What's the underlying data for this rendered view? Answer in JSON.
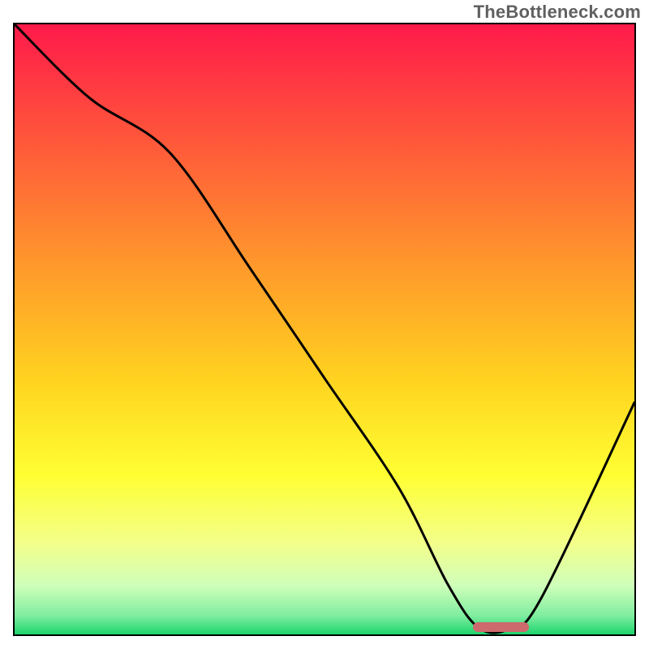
{
  "watermark": "TheBottleneck.com",
  "chart_data": {
    "type": "line",
    "title": "",
    "xlabel": "",
    "ylabel": "",
    "xlim": [
      0,
      100
    ],
    "ylim": [
      0,
      100
    ],
    "grid": false,
    "legend": false,
    "background_gradient": {
      "stops": [
        {
          "offset": 0.0,
          "color": "#ff1a4a"
        },
        {
          "offset": 0.2,
          "color": "#ff5a3a"
        },
        {
          "offset": 0.4,
          "color": "#ff9a2b"
        },
        {
          "offset": 0.58,
          "color": "#ffd21f"
        },
        {
          "offset": 0.74,
          "color": "#ffff33"
        },
        {
          "offset": 0.85,
          "color": "#f3ff8a"
        },
        {
          "offset": 0.92,
          "color": "#cfffba"
        },
        {
          "offset": 0.97,
          "color": "#7eed9f"
        },
        {
          "offset": 1.0,
          "color": "#1cd46c"
        }
      ]
    },
    "series": [
      {
        "name": "bottleneck-curve",
        "x": [
          0,
          12,
          25,
          38,
          50,
          62,
          70,
          75,
          80,
          85,
          100
        ],
        "y": [
          100,
          88,
          79,
          60,
          42,
          24,
          8,
          1,
          1,
          6,
          38
        ]
      }
    ],
    "annotations": [
      {
        "name": "optimal-marker",
        "shape": "rounded-rect",
        "x_range": [
          74,
          83
        ],
        "y": 1.2,
        "color": "#cd6a6d"
      }
    ]
  }
}
